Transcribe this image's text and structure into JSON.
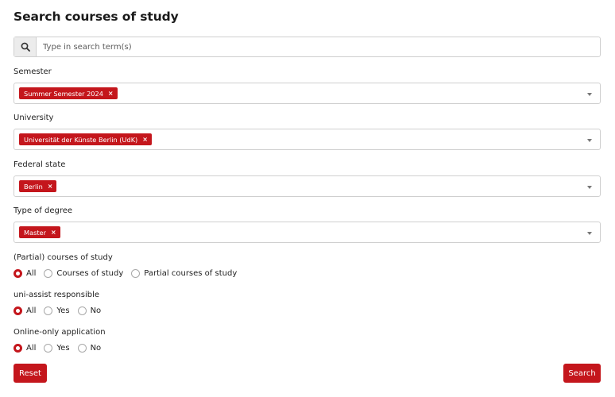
{
  "title": "Search courses of study",
  "search": {
    "placeholder": "Type in search term(s)",
    "icon": "search-icon"
  },
  "filters": {
    "semester": {
      "label": "Semester",
      "tag": "Summer Semester 2024"
    },
    "university": {
      "label": "University",
      "tag": "Universität der Künste Berlin (UdK)"
    },
    "federal_state": {
      "label": "Federal state",
      "tag": "Berlin"
    },
    "degree": {
      "label": "Type of degree",
      "tag": "Master"
    }
  },
  "radio_groups": {
    "courses": {
      "label": "(Partial) courses of study",
      "options": [
        "All",
        "Courses of study",
        "Partial courses of study"
      ],
      "selected": "All"
    },
    "uni_assist": {
      "label": "uni-assist responsible",
      "options": [
        "All",
        "Yes",
        "No"
      ],
      "selected": "All"
    },
    "online_only": {
      "label": "Online-only application",
      "options": [
        "All",
        "Yes",
        "No"
      ],
      "selected": "All"
    }
  },
  "buttons": {
    "reset": "Reset",
    "search": "Search"
  },
  "colors": {
    "accent": "#c4161c",
    "border": "#cfcfcf"
  },
  "tag_remove_glyph": "×"
}
